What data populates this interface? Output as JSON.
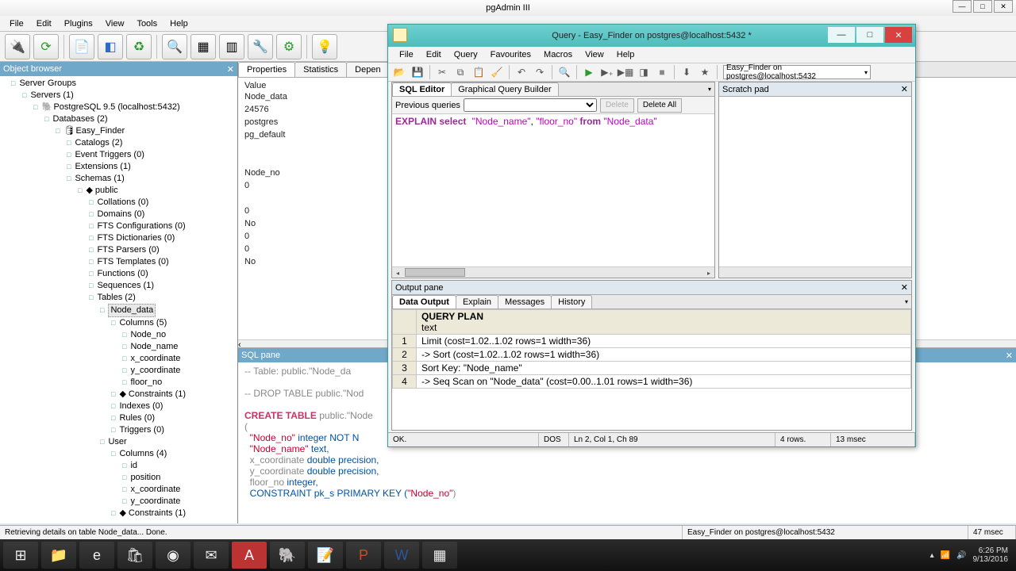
{
  "app_title": "pgAdmin III",
  "menubar": [
    "File",
    "Edit",
    "Plugins",
    "View",
    "Tools",
    "Help"
  ],
  "objbrowser": {
    "title": "Object browser",
    "nodes": {
      "server_groups": "Server Groups",
      "servers": "Servers (1)",
      "server": "PostgreSQL 9.5 (localhost:5432)",
      "databases": "Databases (2)",
      "db": "Easy_Finder",
      "catalogs": "Catalogs (2)",
      "event_triggers": "Event Triggers (0)",
      "extensions": "Extensions (1)",
      "schemas": "Schemas (1)",
      "schema": "public",
      "collations": "Collations (0)",
      "domains": "Domains (0)",
      "fts_conf": "FTS Configurations (0)",
      "fts_dict": "FTS Dictionaries (0)",
      "fts_parsers": "FTS Parsers (0)",
      "fts_templates": "FTS Templates (0)",
      "functions": "Functions (0)",
      "sequences": "Sequences (1)",
      "tables": "Tables (2)",
      "table1": "Node_data",
      "columns5": "Columns (5)",
      "node_no": "Node_no",
      "node_name": "Node_name",
      "x_coord": "x_coordinate",
      "y_coord": "y_coordinate",
      "floor_no": "floor_no",
      "constraints1": "Constraints (1)",
      "indexes0": "Indexes (0)",
      "rules0": "Rules (0)",
      "triggers0": "Triggers (0)",
      "table2": "User",
      "columns4": "Columns (4)",
      "id": "id",
      "position": "position",
      "x_coord2": "x_coordinate",
      "y_coord2": "y_coordinate",
      "constraints1b": "Constraints (1)"
    }
  },
  "properties": {
    "tabs": [
      "Properties",
      "Statistics",
      "Depen"
    ],
    "value_header": "Value",
    "rows": [
      "Node_data",
      "24576",
      "postgres",
      "pg_default",
      "",
      "Node_no",
      "0",
      "",
      "0",
      "No",
      "0",
      "0",
      "No"
    ]
  },
  "sqlpane": {
    "title": "SQL pane",
    "line1": "-- Table: public.\"Node_da",
    "line2": "-- DROP TABLE public.\"Nod",
    "line3a": "CREATE TABLE",
    "line3b": " public.\"Node",
    "lparen": "(",
    "l4a": "  \"Node_no\"",
    "l4b": " integer NOT N",
    "l5a": "  \"Node_name\"",
    "l5b": " text,",
    "l6a": "  x_coordinate ",
    "l6b": "double precision,",
    "l7a": "  y_coordinate ",
    "l7b": "double precision,",
    "l8a": "  floor_no ",
    "l8b": "integer,",
    "l9a": "  CONSTRAINT pk_s PRIMARY KEY (",
    "l9b": "\"Node_no\"",
    "l9c": ")"
  },
  "query": {
    "title": "Query - Easy_Finder on postgres@localhost:5432 *",
    "menubar": [
      "File",
      "Edit",
      "Query",
      "Favourites",
      "Macros",
      "View",
      "Help"
    ],
    "combo": "Easy_Finder on postgres@localhost:5432",
    "editor_tabs": [
      "SQL Editor",
      "Graphical Query Builder"
    ],
    "prev_label": "Previous queries",
    "delete": "Delete",
    "delete_all": "Delete All",
    "sql_kw": "EXPLAIN select",
    "sql_s1": "\"Node_name\"",
    "sql_c": ", ",
    "sql_s2": "\"floor_no\"",
    "sql_from": " from ",
    "sql_s3": "\"Node_data\"",
    "scratch_title": "Scratch pad",
    "output_title": "Output pane",
    "output_tabs": [
      "Data Output",
      "Explain",
      "Messages",
      "History"
    ],
    "col_header1": "QUERY PLAN",
    "col_header2": "text",
    "rows": [
      "Limit  (cost=1.02..1.02 rows=1 width=36)",
      "  ->  Sort  (cost=1.02..1.02 rows=1 width=36)",
      "        Sort Key: \"Node_name\"",
      "        ->  Seq Scan on \"Node_data\"  (cost=0.00..1.01 rows=1 width=36)"
    ],
    "status": {
      "ok": "OK.",
      "enc": "DOS",
      "pos": "Ln 2, Col 1, Ch 89",
      "rows": "4 rows.",
      "time": "13 msec"
    }
  },
  "statusbar": {
    "msg": "Retrieving details on table Node_data... Done.",
    "conn": "Easy_Finder on postgres@localhost:5432",
    "time": "47 msec"
  },
  "taskbar": {
    "time": "6:26 PM",
    "date": "9/13/2016"
  }
}
